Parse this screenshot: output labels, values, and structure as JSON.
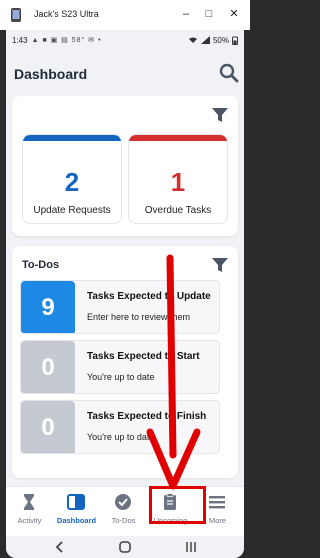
{
  "window": {
    "title": "Jack's S23 Ultra",
    "buttons": {
      "minimize": "–",
      "maximize": "□",
      "close": "✕"
    }
  },
  "status_bar": {
    "time": "1:43",
    "left_icons": "▲ ■ ▣ ▤ 58° ✉ •",
    "battery": "50%"
  },
  "header": {
    "title": "Dashboard"
  },
  "stats": [
    {
      "value": "2",
      "label": "Update Requests",
      "color": "#1565c0"
    },
    {
      "value": "1",
      "label": "Overdue Tasks",
      "color": "#d32f2f"
    }
  ],
  "todos": {
    "title": "To-Dos",
    "items": [
      {
        "count": "9",
        "title": "Tasks Expected to Update",
        "subtitle": "Enter here to review them",
        "color": "#1e88e5"
      },
      {
        "count": "0",
        "title": "Tasks Expected to Start",
        "subtitle": "You're up to date",
        "color": "#c5c9d1"
      },
      {
        "count": "0",
        "title": "Tasks Expected to Finish",
        "subtitle": "You're up to date",
        "color": "#c5c9d1"
      }
    ]
  },
  "nav": {
    "items": [
      {
        "label": "Activity",
        "icon": "hourglass-icon"
      },
      {
        "label": "Dashboard",
        "icon": "dashboard-icon"
      },
      {
        "label": "To-Dos",
        "icon": "check-circle-icon"
      },
      {
        "label": "Upcoming",
        "icon": "clipboard-icon"
      },
      {
        "label": "More",
        "icon": "menu-icon"
      }
    ],
    "active": "Dashboard"
  },
  "colors": {
    "accent": "#1565c0",
    "danger": "#d32f2f",
    "annotation": "#e00000"
  }
}
